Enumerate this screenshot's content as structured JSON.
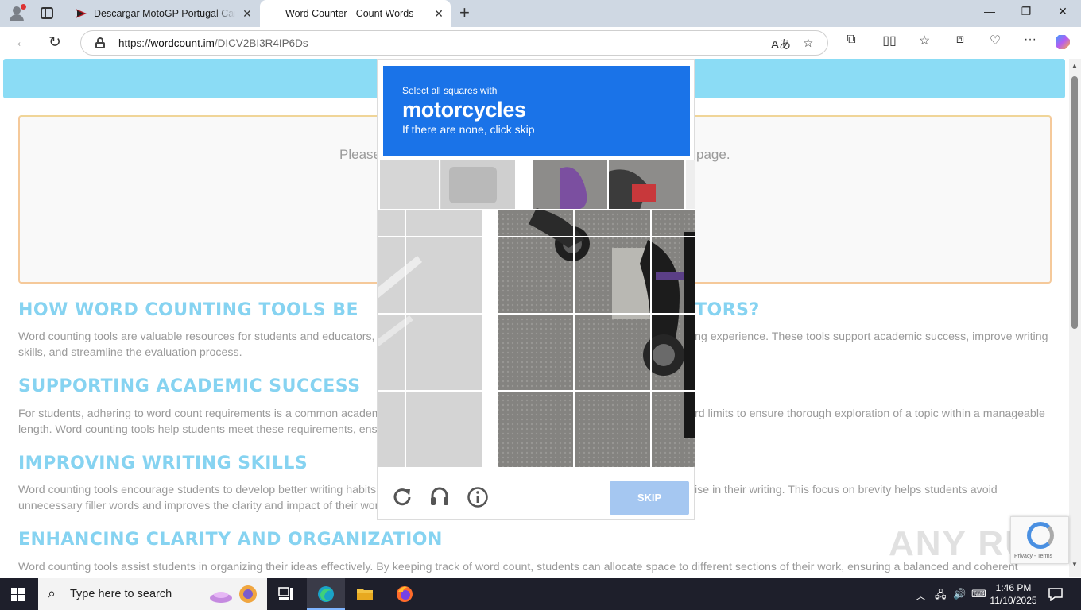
{
  "browser": {
    "tabs": [
      {
        "title": "Descargar MotoGP Portugal Carre",
        "close": "✕"
      },
      {
        "title": "Word Counter - Count Words",
        "close": "✕"
      }
    ],
    "new_tab": "+",
    "window_controls": {
      "minimize": "—",
      "restore": "❐",
      "close": "✕"
    },
    "url": {
      "prefix": "https://",
      "host": "wordcount.im",
      "path": "/DICV2BI3R4IP6Ds"
    }
  },
  "page": {
    "editor_placeholder": "Please",
    "editor_placeholder_tail": "page.",
    "sections": [
      {
        "heading_left": "HOW WORD COUNTING TOOLS BE",
        "heading_right": "TORS?",
        "body_left": "Word counting tools are valuable resources for students and educators, p",
        "body_right": "ng experience. These tools support academic success, improve writing",
        "body_line2": "skills, and streamline the evaluation process."
      },
      {
        "heading_left": "SUPPORTING ACADEMIC SUCCESS",
        "body_left": "For students, adhering to word count requirements is a common academ",
        "body_right": "rd limits to ensure thorough exploration of a topic within a manageable",
        "body_line2": "length. Word counting tools help students meet these requirements, ensu"
      },
      {
        "heading_left": "IMPROVING WRITING SKILLS",
        "body_left": "Word counting tools encourage students to develop better writing habits.",
        "body_right": "ise in their writing. This focus on brevity helps students avoid",
        "body_line2": "unnecessary filler words and improves the clarity and impact of their work"
      },
      {
        "heading_left": "ENHANCING CLARITY AND ORGANIZATION",
        "body_left": "Word counting tools assist students in organizing their ideas effectively. By keeping track of word count, students can allocate space to different sections of their work, ensuring a balanced and coherent"
      }
    ]
  },
  "captcha": {
    "instruction_small": "Select all squares with",
    "target": "motorcycles",
    "hint": "If there are none, click skip",
    "reload_icon": "reload-icon",
    "audio_icon": "headphones-icon",
    "info_icon": "info-icon",
    "skip_label": "SKIP",
    "accent_color": "#1a73e8"
  },
  "recaptcha_badge": {
    "text": "Privacy - Terms"
  },
  "watermark": "ANY RUN",
  "taskbar": {
    "search_placeholder": "Type here to search",
    "time": "1:46 PM",
    "date": "11/10/2025"
  }
}
